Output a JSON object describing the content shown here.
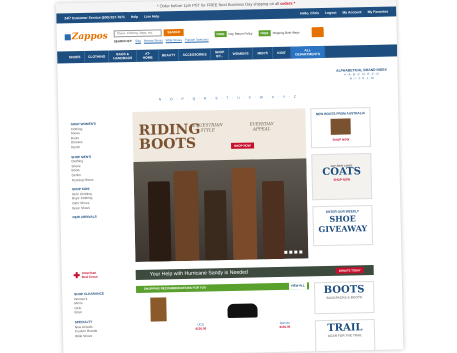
{
  "promo": {
    "text": "* Order before 1pm PST for FREE Next Business Day shipping on all ",
    "tail": "orders *"
  },
  "topbar": {
    "service": "24/7 Customer Service (800) 927-7671",
    "help": "Help",
    "live_help": "Live Help",
    "hello": "Hello, Chris",
    "logout": "Logout",
    "account": "My Account",
    "favorites": "My Favorites"
  },
  "header": {
    "logo": "Zappos",
    "search_placeholder": "Shoes, Clothing, Bags, etc.",
    "search_button": "SEARCH",
    "search_by_label": "SEARCH BY:",
    "search_by": [
      "Size",
      "Narrow Shoes",
      "Wide Shoes",
      "Popular Searches"
    ],
    "badge1": "FREE",
    "badge1_text": "Day Return Policy",
    "badge2": "FREE",
    "badge2_text": "Shipping Both Ways"
  },
  "nav": [
    {
      "label": "SHOES",
      "active": false
    },
    {
      "label": "CLOTHING",
      "active": false
    },
    {
      "label": "BAGS & HANDBAGS",
      "active": false
    },
    {
      "label": "AT-HOME",
      "active": false
    },
    {
      "label": "BEAUTY",
      "active": false
    },
    {
      "label": "ACCESSORIES",
      "active": false
    },
    {
      "label": "SHOP BY...",
      "active": false
    },
    {
      "label": "WOMEN'S",
      "active": false
    },
    {
      "label": "MEN'S",
      "active": false
    },
    {
      "label": "KIDS'",
      "active": false
    },
    {
      "label": "ALL DEPARTMENTS",
      "active": true
    }
  ],
  "brand_index": {
    "title": "ALPHABETICAL BRAND INDEX",
    "row1": "# · A · B · C · D · E · F · G",
    "row2": "H · I · J · K · L · M",
    "row3": "N · O · P · Q · R · S · T · U · V · W · X · Y · Z"
  },
  "sidebar": {
    "sections": [
      {
        "heading": "SHOP WOMEN'S",
        "items": [
          "Clothing",
          "Shoes",
          "Boots",
          "Dresses",
          "Denim"
        ]
      },
      {
        "heading": "SHOP MEN'S",
        "items": [
          "Clothing",
          "Shoes",
          "Boots",
          "Denim",
          "Running Shoes"
        ]
      },
      {
        "heading": "SHOP KIDS'",
        "items": [
          "Girls' Clothing",
          "Boys' Clothing",
          "Girls' Shoes",
          "Boys' Shoes"
        ]
      },
      {
        "heading": "NEW ARRIVALS",
        "items": []
      }
    ]
  },
  "hero": {
    "title": "RIDING BOOTS",
    "sub1": "EQUESTRIAN STYLE",
    "sub2": "EVERYDAY APPEAL",
    "shop": "SHOP NOW"
  },
  "right_promos": [
    {
      "cap": "NEW BOOTS FROM AUSTRALIA",
      "big": "",
      "sm": "SHOP NOW"
    },
    {
      "cap": "our best coats",
      "big": "COATS",
      "sm": "SHOP NOW"
    },
    {
      "cap": "ENTER OUR WEEKLY",
      "big": "SHOE GIVEAWAY",
      "sm": ""
    }
  ],
  "redcross": {
    "line1": "American",
    "line2": "Red Cross"
  },
  "sandy": {
    "text": "Your Help with Hurricane Sandy is Needed",
    "button": "DONATE TODAY"
  },
  "sidebar_lower": {
    "sections": [
      {
        "heading": "SHOP CLEARANCE",
        "items": [
          "Women's",
          "Men's",
          "Girls'",
          "Boys'"
        ]
      },
      {
        "heading": "SPECIALTY",
        "items": [
          "New Arrivals",
          "Couture Brands",
          "Wide Shoes"
        ]
      }
    ]
  },
  "recs": {
    "heading": "SHOPPING RECOMMENDATIONS FOR YOU",
    "view_all": "VIEW ALL",
    "products": [
      {
        "name": "",
        "price": "",
        "color": "#8a5a2b"
      },
      {
        "name": "UGG",
        "price": "$120.00",
        "color": "#a0a0a0"
      },
      {
        "name": "",
        "price": "",
        "color": "#111111"
      },
      {
        "name": "Dansko",
        "price": "$130.00",
        "color": "#999999"
      }
    ]
  },
  "right_lower": [
    {
      "big": "BOOTS",
      "cap": "BACKPACKS & BOOTS"
    },
    {
      "big": "TRAIL",
      "cap": "GEAR FOR THE TRAIL"
    }
  ],
  "colors": {
    "navy": "#1d4e7f",
    "orange": "#e57200",
    "red": "#c8102e",
    "green": "#5aa02c"
  }
}
